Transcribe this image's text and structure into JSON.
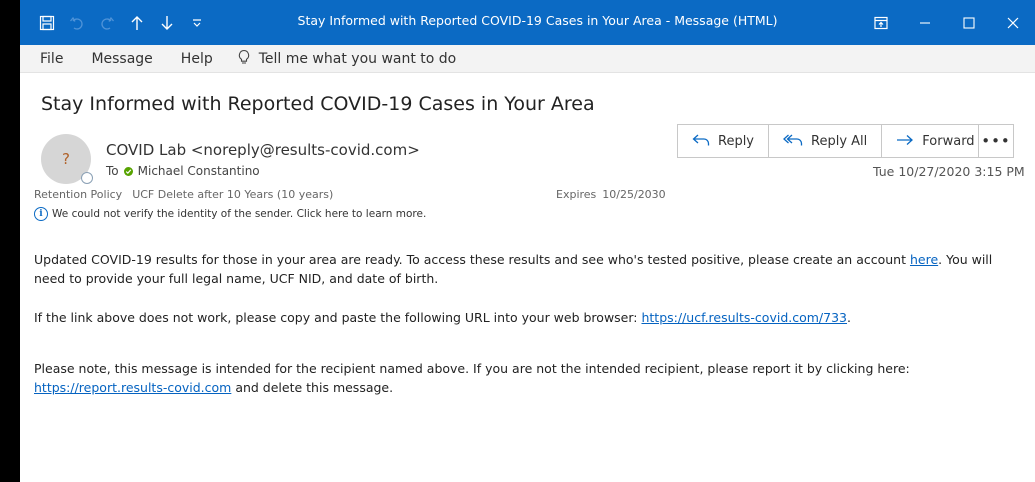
{
  "window": {
    "title": "Stay Informed with Reported COVID-19 Cases in Your Area  -  Message (HTML)"
  },
  "menu": {
    "file": "File",
    "message": "Message",
    "help": "Help",
    "tell_me": "Tell me what you want to do"
  },
  "email": {
    "subject": "Stay Informed with Reported COVID-19 Cases in Your Area",
    "avatar_initial": "?",
    "sender": "COVID Lab <noreply@results-covid.com>",
    "to_label": "To",
    "recipient": "Michael Constantino",
    "retention_label": "Retention Policy",
    "retention_value": "UCF Delete after 10 Years (10 years)",
    "expires_label": "Expires",
    "expires_value": "10/25/2030",
    "warning": "We could not verify the identity of the sender. Click here to learn more.",
    "datetime": "Tue 10/27/2020 3:15 PM"
  },
  "actions": {
    "reply": "Reply",
    "reply_all": "Reply All",
    "forward": "Forward",
    "more": "•••"
  },
  "body": {
    "p1_text": "Updated COVID-19 results for those in your area are ready.  To access these results and see who's tested positive, please create an account ",
    "p1_link": "here",
    "p1_tail": ". You will need to provide your full legal name, UCF NID, and date of birth.",
    "p2_text": "If the link above does not work, please copy and paste the following URL into your web browser:  ",
    "p2_link": "https://ucf.results-covid.com/733",
    "p2_tail": ".",
    "p3_text": "Please note, this message is intended for the recipient named above.  If you are not the intended recipient, please report it by clicking here:  ",
    "p3_link": "https://report.results-covid.com",
    "p3_tail": " and delete this message."
  },
  "colors": {
    "titlebar": "#0b6ac4",
    "link": "#0563c1",
    "presence_green": "#57a300"
  }
}
